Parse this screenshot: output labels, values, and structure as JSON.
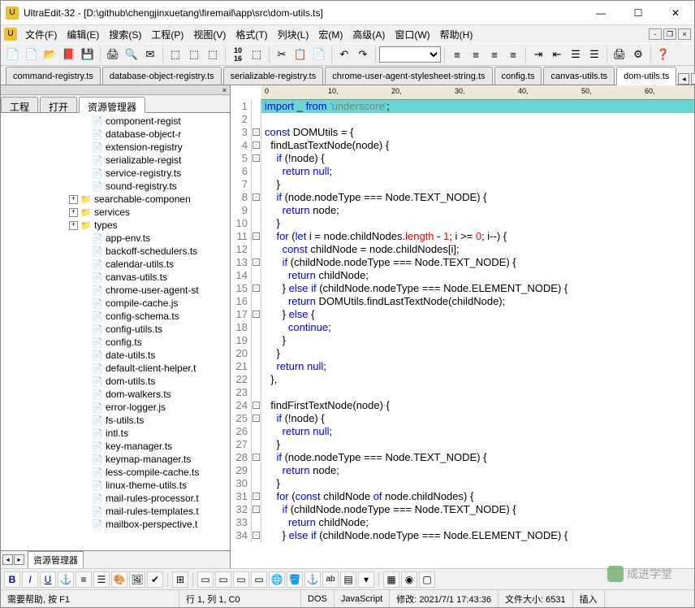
{
  "title": "UltraEdit-32 - [D:\\github\\chengjinxuetang\\firemail\\app\\src\\dom-utils.ts]",
  "menu": {
    "file": "文件(F)",
    "edit": "编辑(E)",
    "search": "搜索(S)",
    "project": "工程(P)",
    "view": "视图(V)",
    "format": "格式(T)",
    "column": "列块(L)",
    "macro": "宏(M)",
    "advanced": "高级(A)",
    "window": "窗口(W)",
    "help": "帮助(H)"
  },
  "fileTabs": [
    "command-registry.ts",
    "database-object-registry.ts",
    "serializable-registry.ts",
    "chrome-user-agent-stylesheet-string.ts",
    "config.ts",
    "canvas-utils.ts",
    "dom-utils.ts"
  ],
  "activeFileTab": 6,
  "sidePanel": {
    "tabs": {
      "project": "工程",
      "open": "打开",
      "explorer": "资源管理器"
    },
    "bottomTab": "资源管理器",
    "files": [
      {
        "type": "file",
        "indent": 7,
        "name": "component-regist"
      },
      {
        "type": "file",
        "indent": 7,
        "name": "database-object-r"
      },
      {
        "type": "file",
        "indent": 7,
        "name": "extension-registry"
      },
      {
        "type": "file",
        "indent": 7,
        "name": "serializable-regist"
      },
      {
        "type": "file",
        "indent": 7,
        "name": "service-registry.ts"
      },
      {
        "type": "file",
        "indent": 7,
        "name": "sound-registry.ts"
      },
      {
        "type": "folder",
        "indent": 6,
        "exp": "+",
        "name": "searchable-componen"
      },
      {
        "type": "folder",
        "indent": 6,
        "exp": "+",
        "name": "services"
      },
      {
        "type": "folder",
        "indent": 6,
        "exp": "+",
        "name": "types"
      },
      {
        "type": "file",
        "indent": 7,
        "name": "app-env.ts"
      },
      {
        "type": "file",
        "indent": 7,
        "name": "backoff-schedulers.ts"
      },
      {
        "type": "file",
        "indent": 7,
        "name": "calendar-utils.ts"
      },
      {
        "type": "file",
        "indent": 7,
        "name": "canvas-utils.ts"
      },
      {
        "type": "file",
        "indent": 7,
        "name": "chrome-user-agent-st"
      },
      {
        "type": "file",
        "indent": 7,
        "name": "compile-cache.js"
      },
      {
        "type": "file",
        "indent": 7,
        "name": "config-schema.ts"
      },
      {
        "type": "file",
        "indent": 7,
        "name": "config-utils.ts"
      },
      {
        "type": "file",
        "indent": 7,
        "name": "config.ts"
      },
      {
        "type": "file",
        "indent": 7,
        "name": "date-utils.ts"
      },
      {
        "type": "file",
        "indent": 7,
        "name": "default-client-helper.t"
      },
      {
        "type": "file",
        "indent": 7,
        "name": "dom-utils.ts"
      },
      {
        "type": "file",
        "indent": 7,
        "name": "dom-walkers.ts"
      },
      {
        "type": "file",
        "indent": 7,
        "name": "error-logger.js"
      },
      {
        "type": "file",
        "indent": 7,
        "name": "fs-utils.ts"
      },
      {
        "type": "file",
        "indent": 7,
        "name": "intl.ts"
      },
      {
        "type": "file",
        "indent": 7,
        "name": "key-manager.ts"
      },
      {
        "type": "file",
        "indent": 7,
        "name": "keymap-manager.ts"
      },
      {
        "type": "file",
        "indent": 7,
        "name": "less-compile-cache.ts"
      },
      {
        "type": "file",
        "indent": 7,
        "name": "linux-theme-utils.ts"
      },
      {
        "type": "file",
        "indent": 7,
        "name": "mail-rules-processor.t"
      },
      {
        "type": "file",
        "indent": 7,
        "name": "mail-rules-templates.t"
      },
      {
        "type": "file",
        "indent": 7,
        "name": "mailbox-perspective.t"
      }
    ]
  },
  "ruler": {
    "ticks": [
      0,
      10,
      20,
      30,
      40,
      50,
      60
    ]
  },
  "code": [
    {
      "n": 1,
      "f": "",
      "hl": true,
      "h": "<span class='kw'>import</span> _ <span class='kw'>from</span> <span class='str'>'underscore'</span>;"
    },
    {
      "n": 2,
      "f": "",
      "h": ""
    },
    {
      "n": 3,
      "f": "-",
      "h": "<span class='kw'>const</span> DOMUtils = {"
    },
    {
      "n": 4,
      "f": "-",
      "h": "  findLastTextNode(node) {"
    },
    {
      "n": 5,
      "f": "-",
      "h": "    <span class='kw'>if</span> (!node) {"
    },
    {
      "n": 6,
      "f": "",
      "h": "      <span class='kw'>return</span> <span class='kw'>null</span>;"
    },
    {
      "n": 7,
      "f": "",
      "h": "    }"
    },
    {
      "n": 8,
      "f": "-",
      "h": "    <span class='kw'>if</span> (node.nodeType === Node.TEXT_NODE) {"
    },
    {
      "n": 9,
      "f": "",
      "h": "      <span class='kw'>return</span> node;"
    },
    {
      "n": 10,
      "f": "",
      "h": "    }"
    },
    {
      "n": 11,
      "f": "-",
      "h": "    <span class='kw'>for</span> (<span class='kw'>let</span> i = node.childNodes.<span class='num'>length</span> - <span class='num'>1</span>; i >= <span class='num'>0</span>; i--) {"
    },
    {
      "n": 12,
      "f": "",
      "h": "      <span class='kw'>const</span> childNode = node.childNodes[i];"
    },
    {
      "n": 13,
      "f": "-",
      "h": "      <span class='kw'>if</span> (childNode.nodeType === Node.TEXT_NODE) {"
    },
    {
      "n": 14,
      "f": "",
      "h": "        <span class='kw'>return</span> childNode;"
    },
    {
      "n": 15,
      "f": "-",
      "h": "      } <span class='kw'>else</span> <span class='kw'>if</span> (childNode.nodeType === Node.ELEMENT_NODE) {"
    },
    {
      "n": 16,
      "f": "",
      "h": "        <span class='kw'>return</span> DOMUtils.findLastTextNode(childNode);"
    },
    {
      "n": 17,
      "f": "-",
      "h": "      } <span class='kw'>else</span> {"
    },
    {
      "n": 18,
      "f": "",
      "h": "        <span class='kw'>continue</span>;"
    },
    {
      "n": 19,
      "f": "",
      "h": "      }"
    },
    {
      "n": 20,
      "f": "",
      "h": "    }"
    },
    {
      "n": 21,
      "f": "",
      "h": "    <span class='kw'>return</span> <span class='kw'>null</span>;"
    },
    {
      "n": 22,
      "f": "",
      "h": "  },"
    },
    {
      "n": 23,
      "f": "",
      "h": ""
    },
    {
      "n": 24,
      "f": "-",
      "h": "  findFirstTextNode(node) {"
    },
    {
      "n": 25,
      "f": "-",
      "h": "    <span class='kw'>if</span> (!node) {"
    },
    {
      "n": 26,
      "f": "",
      "h": "      <span class='kw'>return</span> <span class='kw'>null</span>;"
    },
    {
      "n": 27,
      "f": "",
      "h": "    }"
    },
    {
      "n": 28,
      "f": "-",
      "h": "    <span class='kw'>if</span> (node.nodeType === Node.TEXT_NODE) {"
    },
    {
      "n": 29,
      "f": "",
      "h": "      <span class='kw'>return</span> node;"
    },
    {
      "n": 30,
      "f": "",
      "h": "    }"
    },
    {
      "n": 31,
      "f": "-",
      "h": "    <span class='kw'>for</span> (<span class='kw'>const</span> childNode <span class='kw'>of</span> node.childNodes) {"
    },
    {
      "n": 32,
      "f": "-",
      "h": "      <span class='kw'>if</span> (childNode.nodeType === Node.TEXT_NODE) {"
    },
    {
      "n": 33,
      "f": "",
      "h": "        <span class='kw'>return</span> childNode;"
    },
    {
      "n": 34,
      "f": "-",
      "h": "      } <span class='kw'>else</span> <span class='kw'>if</span> (childNode.nodeType === Node.ELEMENT_NODE) {"
    }
  ],
  "status": {
    "help": "需要帮助, 按 F1",
    "pos": "行 1, 列 1, C0",
    "enc": "DOS",
    "lang": "JavaScript",
    "modified": "修改: 2021/7/1 17:43:36",
    "size": "文件大小: 6531",
    "mode": "插入"
  },
  "watermark": "成进学堂"
}
